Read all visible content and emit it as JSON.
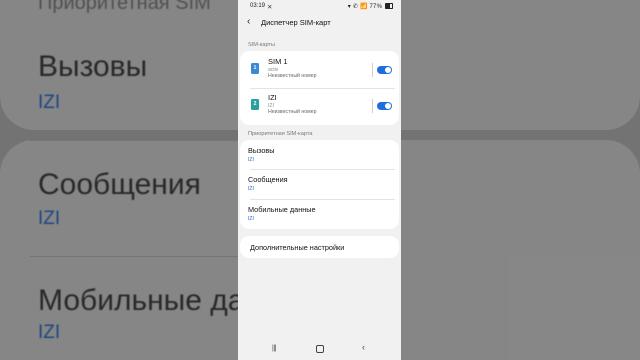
{
  "background": {
    "top_partial": "Приоритетная SIM",
    "items": [
      {
        "label": "Вызовы",
        "value": "IZI"
      },
      {
        "label": "Сообщения",
        "value": "IZI"
      },
      {
        "label": "Мобильные да",
        "value": "IZI"
      }
    ]
  },
  "status_bar": {
    "time": "03:19",
    "icons_text": "▾ ✆ 📶 77%"
  },
  "header": {
    "title": "Диспетчер SIM-карт"
  },
  "sim_section": {
    "label": "SIM-карты",
    "cards": [
      {
        "name": "SIM 1",
        "carrier": "activ",
        "number": "Неизвестный номер",
        "icon_text": "1",
        "enabled": true
      },
      {
        "name": "IZI",
        "carrier": "IZI",
        "number": "Неизвестный номер",
        "icon_text": "2",
        "enabled": true
      }
    ]
  },
  "priority_section": {
    "label": "Приоритетная SIM-карта",
    "items": [
      {
        "label": "Вызовы",
        "value": "IZI"
      },
      {
        "label": "Сообщения",
        "value": "IZI"
      },
      {
        "label": "Мобильные данные",
        "value": "IZI"
      }
    ]
  },
  "more_settings": {
    "label": "Дополнительные настройки"
  },
  "colors": {
    "accent": "#1e6fdc",
    "value_text": "#1f5fbf",
    "sim1_icon": "#3a8ad6",
    "sim2_icon": "#29a1a0"
  }
}
